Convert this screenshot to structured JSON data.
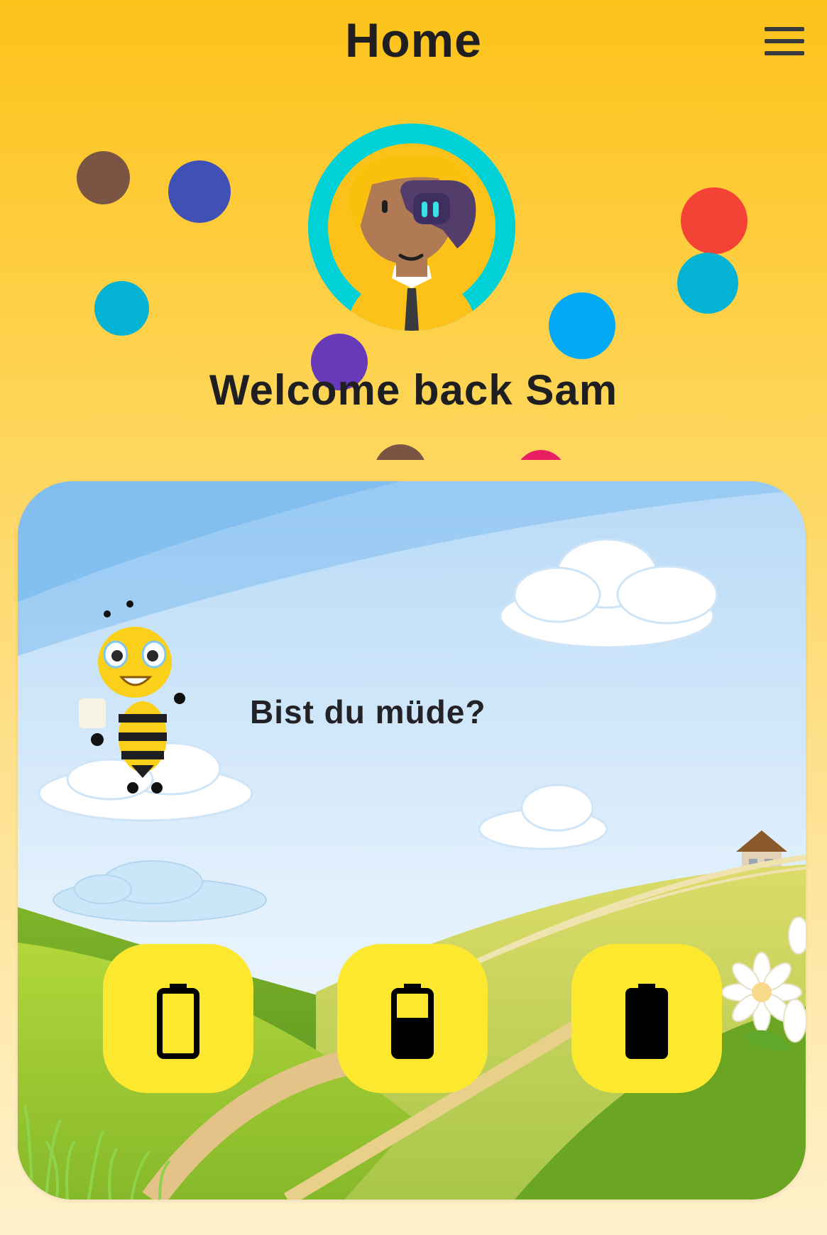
{
  "header": {
    "title": "Home",
    "menu_icon": "hamburger-menu-icon"
  },
  "profile": {
    "avatar_icon": "user-avatar",
    "welcome_text": "Welcome back Sam"
  },
  "colors": {
    "background_top": "#fdc21a",
    "background_bottom": "#fff1cc",
    "avatar_ring": "#00d1d6",
    "button_yellow": "#fde830",
    "text_dark": "#1f1f21"
  },
  "card": {
    "mascot_icon": "bee-mascot",
    "question": "Bist du müde?",
    "answers": [
      {
        "icon": "battery-empty-icon",
        "charge_level": 0
      },
      {
        "icon": "battery-half-icon",
        "charge_level": 0.6
      },
      {
        "icon": "battery-full-icon",
        "charge_level": 1
      }
    ]
  }
}
